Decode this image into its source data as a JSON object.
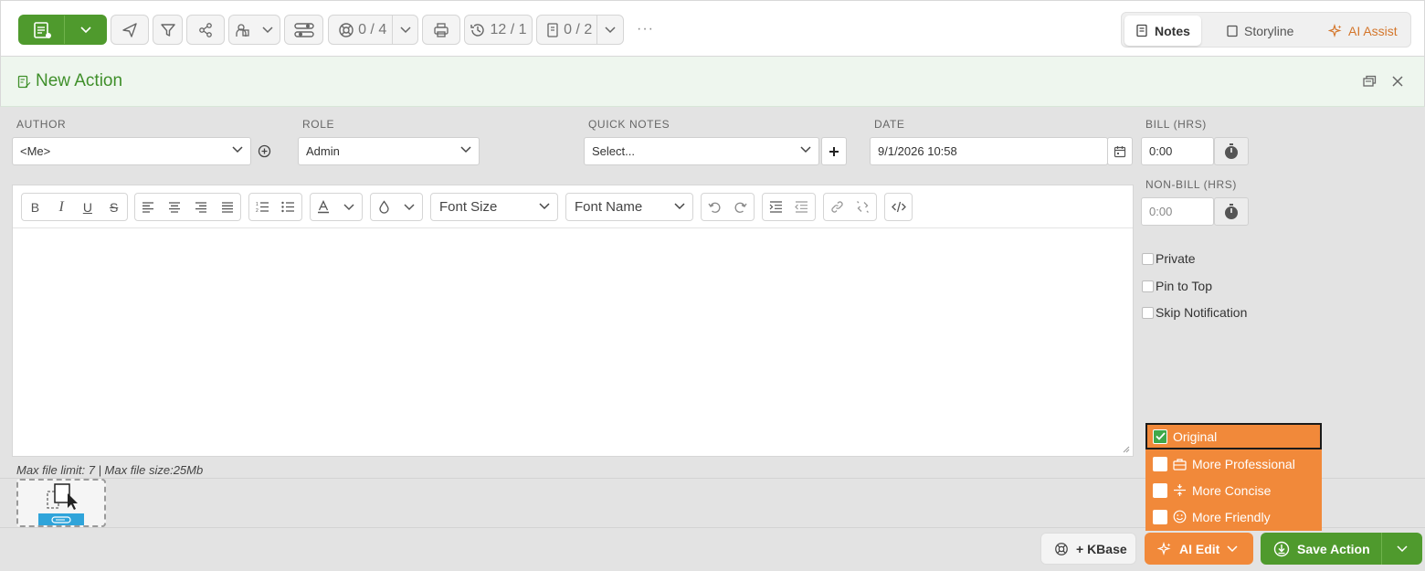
{
  "toolbar": {
    "history_count": "12 / 1",
    "tickets_count": "0 / 4",
    "docs_count": "0 / 2",
    "more": "···",
    "right_tabs": [
      {
        "label": "Notes",
        "icon": "notes-icon"
      },
      {
        "label": "Storyline",
        "icon": "storyline-icon"
      },
      {
        "label": "AI Assist",
        "icon": "sparkle-icon"
      }
    ]
  },
  "header": {
    "title": "New Action"
  },
  "form": {
    "author_label": "AUTHOR",
    "author_value": "<Me>",
    "role_label": "ROLE",
    "role_value": "Admin",
    "quick_notes_label": "QUICK NOTES",
    "quick_notes_placeholder": "Select...",
    "date_label": "DATE",
    "date_value": "9/1/2026 10:58",
    "bill_label": "BILL (HRS)",
    "bill_value": "0:00",
    "nonbill_label": "NON-BILL (HRS)",
    "nonbill_placeholder": "0:00"
  },
  "editor": {
    "font_size": "Font Size",
    "font_name": "Font Name"
  },
  "options": {
    "private": "Private",
    "pin_to_top": "Pin to Top",
    "skip_notification": "Skip Notification"
  },
  "attachments": {
    "limit_text": "Max file limit: 7 | Max file size:25Mb"
  },
  "ai_menu": {
    "items": [
      {
        "label": "Original",
        "checked": true
      },
      {
        "label": "More Professional",
        "icon": "briefcase-icon",
        "checked": false
      },
      {
        "label": "More Concise",
        "icon": "compress-icon",
        "checked": false
      },
      {
        "label": "More Friendly",
        "icon": "smile-icon",
        "checked": false
      }
    ]
  },
  "buttons": {
    "kbase": "+ KBase",
    "ai_edit": "AI Edit",
    "save_action": "Save Action"
  },
  "colors": {
    "green": "#4f9a2d",
    "orange": "#f1893a",
    "header_bg": "#eef6ee",
    "title_green": "#3f8f2a"
  }
}
